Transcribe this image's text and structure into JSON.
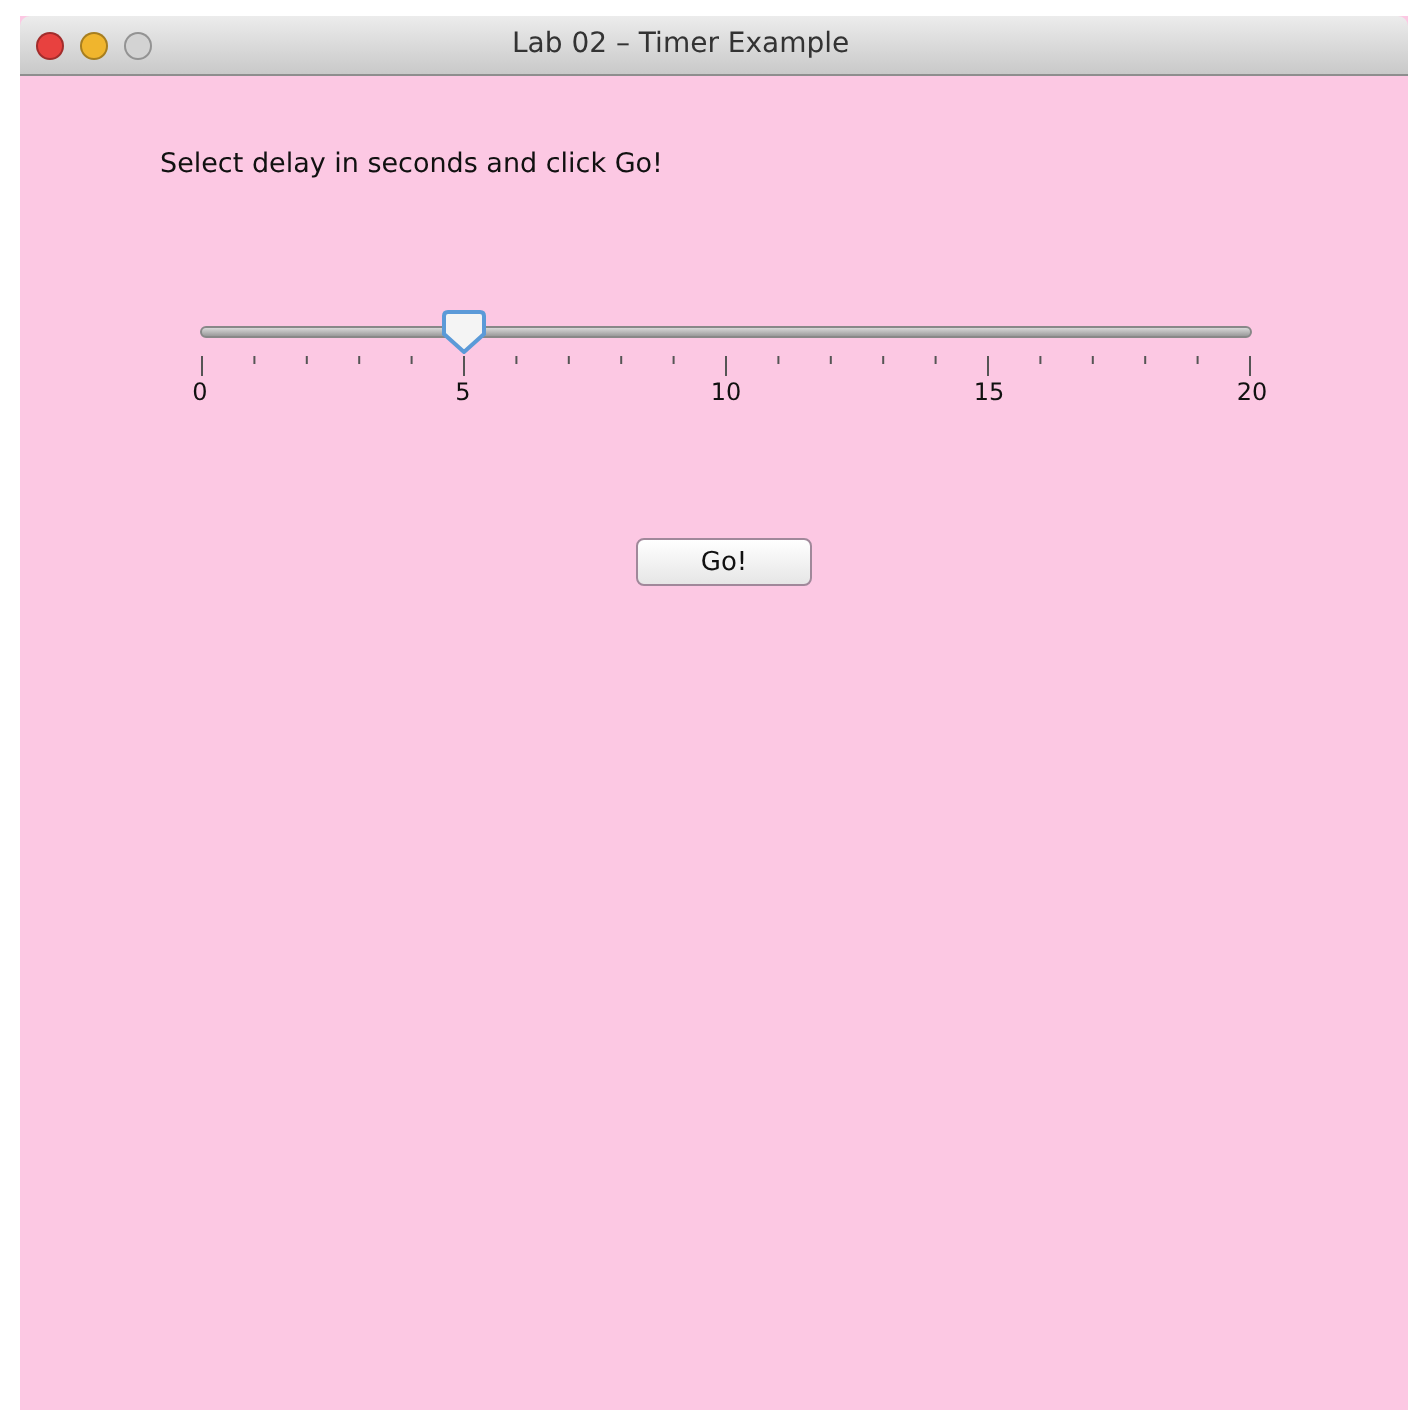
{
  "window": {
    "title": "Lab 02 – Timer Example"
  },
  "instruction": "Select delay in seconds and click Go!",
  "slider": {
    "level": 0.25,
    "tick_labels": [
      "0",
      "5",
      "10",
      "15",
      "20"
    ]
  },
  "button": {
    "label": "Go!"
  }
}
